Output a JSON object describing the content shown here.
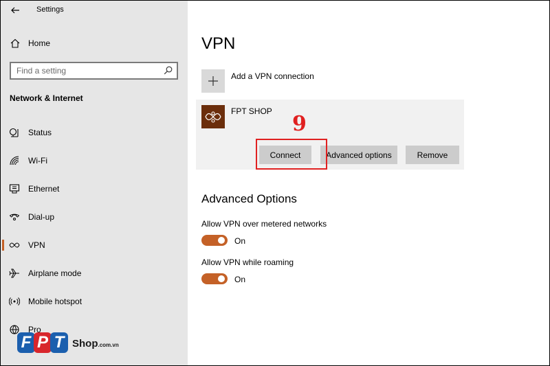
{
  "window": {
    "title": "Settings"
  },
  "sidebar": {
    "home_label": "Home",
    "search_placeholder": "Find a setting",
    "section_title": "Network & Internet",
    "items": [
      {
        "label": "Status",
        "icon": "status-icon"
      },
      {
        "label": "Wi-Fi",
        "icon": "wifi-icon"
      },
      {
        "label": "Ethernet",
        "icon": "ethernet-icon"
      },
      {
        "label": "Dial-up",
        "icon": "dial-up-icon"
      },
      {
        "label": "VPN",
        "icon": "vpn-icon",
        "active": true
      },
      {
        "label": "Airplane mode",
        "icon": "airplane-icon"
      },
      {
        "label": "Mobile hotspot",
        "icon": "hotspot-icon"
      },
      {
        "label": "Pro",
        "icon": "proxy-icon"
      }
    ]
  },
  "main": {
    "title": "VPN",
    "add_connection_label": "Add a VPN connection",
    "connection": {
      "name": "FPT SHOP",
      "buttons": {
        "connect": "Connect",
        "advanced": "Advanced options",
        "remove": "Remove"
      }
    },
    "annotation_step": "9",
    "advanced_title": "Advanced Options",
    "options": [
      {
        "label": "Allow VPN over metered networks",
        "state": "On"
      },
      {
        "label": "Allow VPN while roaming",
        "state": "On"
      }
    ]
  },
  "watermark": {
    "letters": [
      "F",
      "P",
      "T"
    ],
    "brand": "Shop",
    "domain": ".com.vn"
  },
  "colors": {
    "accent": "#c46127",
    "annotation": "#e02020",
    "vpn_tile": "#6b2e0c",
    "sidebar_bg": "#e6e6e6"
  }
}
